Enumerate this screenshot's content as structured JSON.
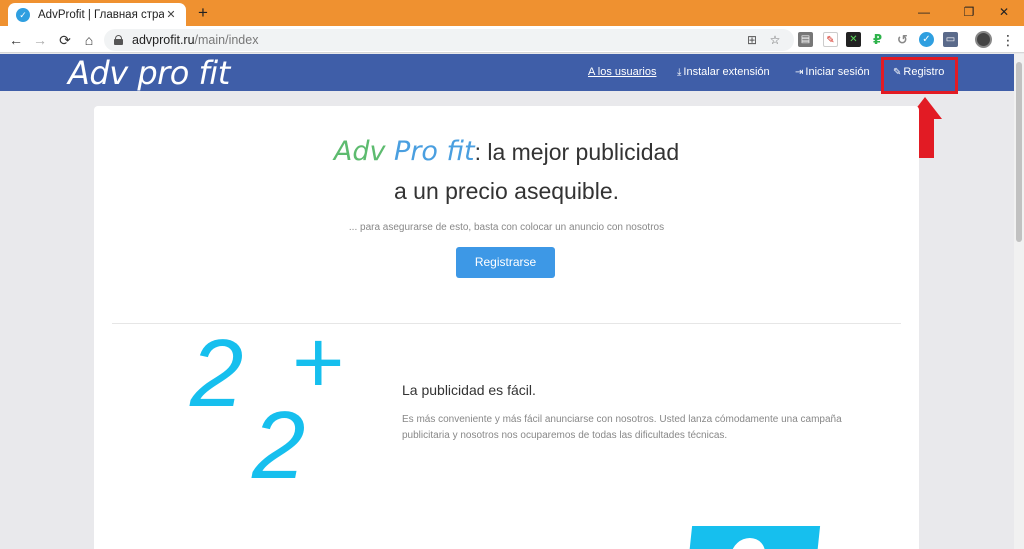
{
  "browser": {
    "tab_title": "AdvProfit | Главная страница",
    "tab_close": "✕",
    "new_tab": "+",
    "window_controls": [
      "—",
      "❐",
      "✕"
    ],
    "url_host": "advprofit.ru",
    "url_path": "/main/index",
    "nav_back": "←",
    "nav_forward": "→",
    "nav_reload": "⟳",
    "nav_home": "⌂",
    "icons": [
      "translate-icon",
      "star-icon"
    ],
    "extension_icons": [
      "ext-grey",
      "ext-pdf",
      "ext-green-x",
      "ext-ruble",
      "ext-clock",
      "ext-check",
      "ext-monitor"
    ],
    "menu": "⋮"
  },
  "site": {
    "logo": "Adv pro fit",
    "nav": {
      "users": "A los usuarios",
      "install": "Instalar extensión",
      "login": "Iniciar sesión",
      "register": "Registro"
    }
  },
  "hero": {
    "brand_part1": "Adv ",
    "brand_part2": "Pro fit",
    "line1_rest": ": la mejor publicidad",
    "line2": "a un precio asequible.",
    "subtitle": "... para asegurarse de esto, basta con colocar un anuncio con nosotros",
    "cta": "Registrarse"
  },
  "feature": {
    "graphic_digit_1": "2",
    "graphic_plus": "+",
    "graphic_digit_2": "2",
    "title": "La publicidad es fácil.",
    "text": "Es más conveniente y más fácil anunciarse con nosotros. Usted lanza cómodamente una campaña publicitaria y nosotros nos ocuparemos de todas las dificultades técnicas."
  },
  "colors": {
    "tabstrip": "#ef9130",
    "header": "#3f5ea8",
    "accent": "#16bfee",
    "button": "#3d98e6",
    "highlight": "#e21b24"
  }
}
